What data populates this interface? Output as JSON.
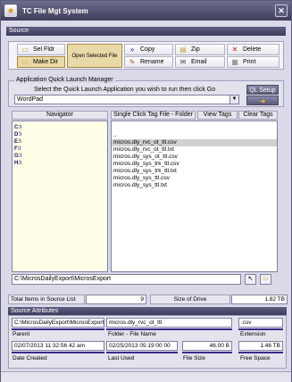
{
  "window": {
    "title": "TC File Mgt System",
    "close_glyph": "✕"
  },
  "source": {
    "header": "Source",
    "buttons": {
      "sel_fldr": "Sel Fldr",
      "make_dir": "Make Dir",
      "open_selected": "Open Selected File",
      "copy": "Copy",
      "rename": "Rename",
      "zip": "Zip",
      "email": "Email",
      "delete": "Delete",
      "print": "Print"
    }
  },
  "quick_launch": {
    "legend": "Application Quick Launch   Manager",
    "instruction": "Select the Quick Launch Application you wish to run then click Go",
    "selected_app": "WordPad",
    "setup_label": "QL Setup",
    "go_label": "Go"
  },
  "navigator": {
    "title": "Navigator",
    "drives": [
      "C:\\",
      "D:\\",
      "E:\\",
      "F:\\",
      "G:\\",
      "H:\\"
    ]
  },
  "files": {
    "tab_single": "Single Click Tag File - Folder",
    "tab_view": "View Tags",
    "tab_clear": "Clear Tags",
    "items": [
      "..",
      "micros.dly_rvc_ot_ttl.csv",
      "micros.dly_rvc_ot_ttl.txt",
      "micros.dly_sys_ot_ttl.csv",
      "micros.dly_sys_trk_ttl.csv",
      "micros.dly_sys_trk_ttl.txt",
      "micros.dly_sys_ttl.csv",
      "micros.dly_sys_ttl.txt"
    ],
    "selected_index": 1
  },
  "path": {
    "value": "C:\\MicrosDailyExport\\MicrosExport"
  },
  "totals": {
    "items_label": "Total Items in Source List",
    "items_value": "9",
    "drive_label": "Size of Drive",
    "drive_value": "1.82 TB"
  },
  "attributes": {
    "header": "Source Attributes",
    "parent_value": "C:\\MicrosDailyExport\\MicrosExport",
    "parent_label": "Parent",
    "folder_file_value": "micros.dly_rvc_ot_ttl",
    "folder_file_label": "Folder - File Name",
    "extension_value": ".csv",
    "extension_label": "Extension",
    "date_created_value": "02/07/2013 11:32:56 42 am",
    "date_created_label": "Date Created",
    "last_used_value": "02/25/2013 05:19:00 00",
    "last_used_label": "Last Used",
    "file_size_value": "46.00 B",
    "file_size_label": "File Size",
    "free_space_value": "1.46 TB",
    "free_space_label": "Free Space"
  }
}
